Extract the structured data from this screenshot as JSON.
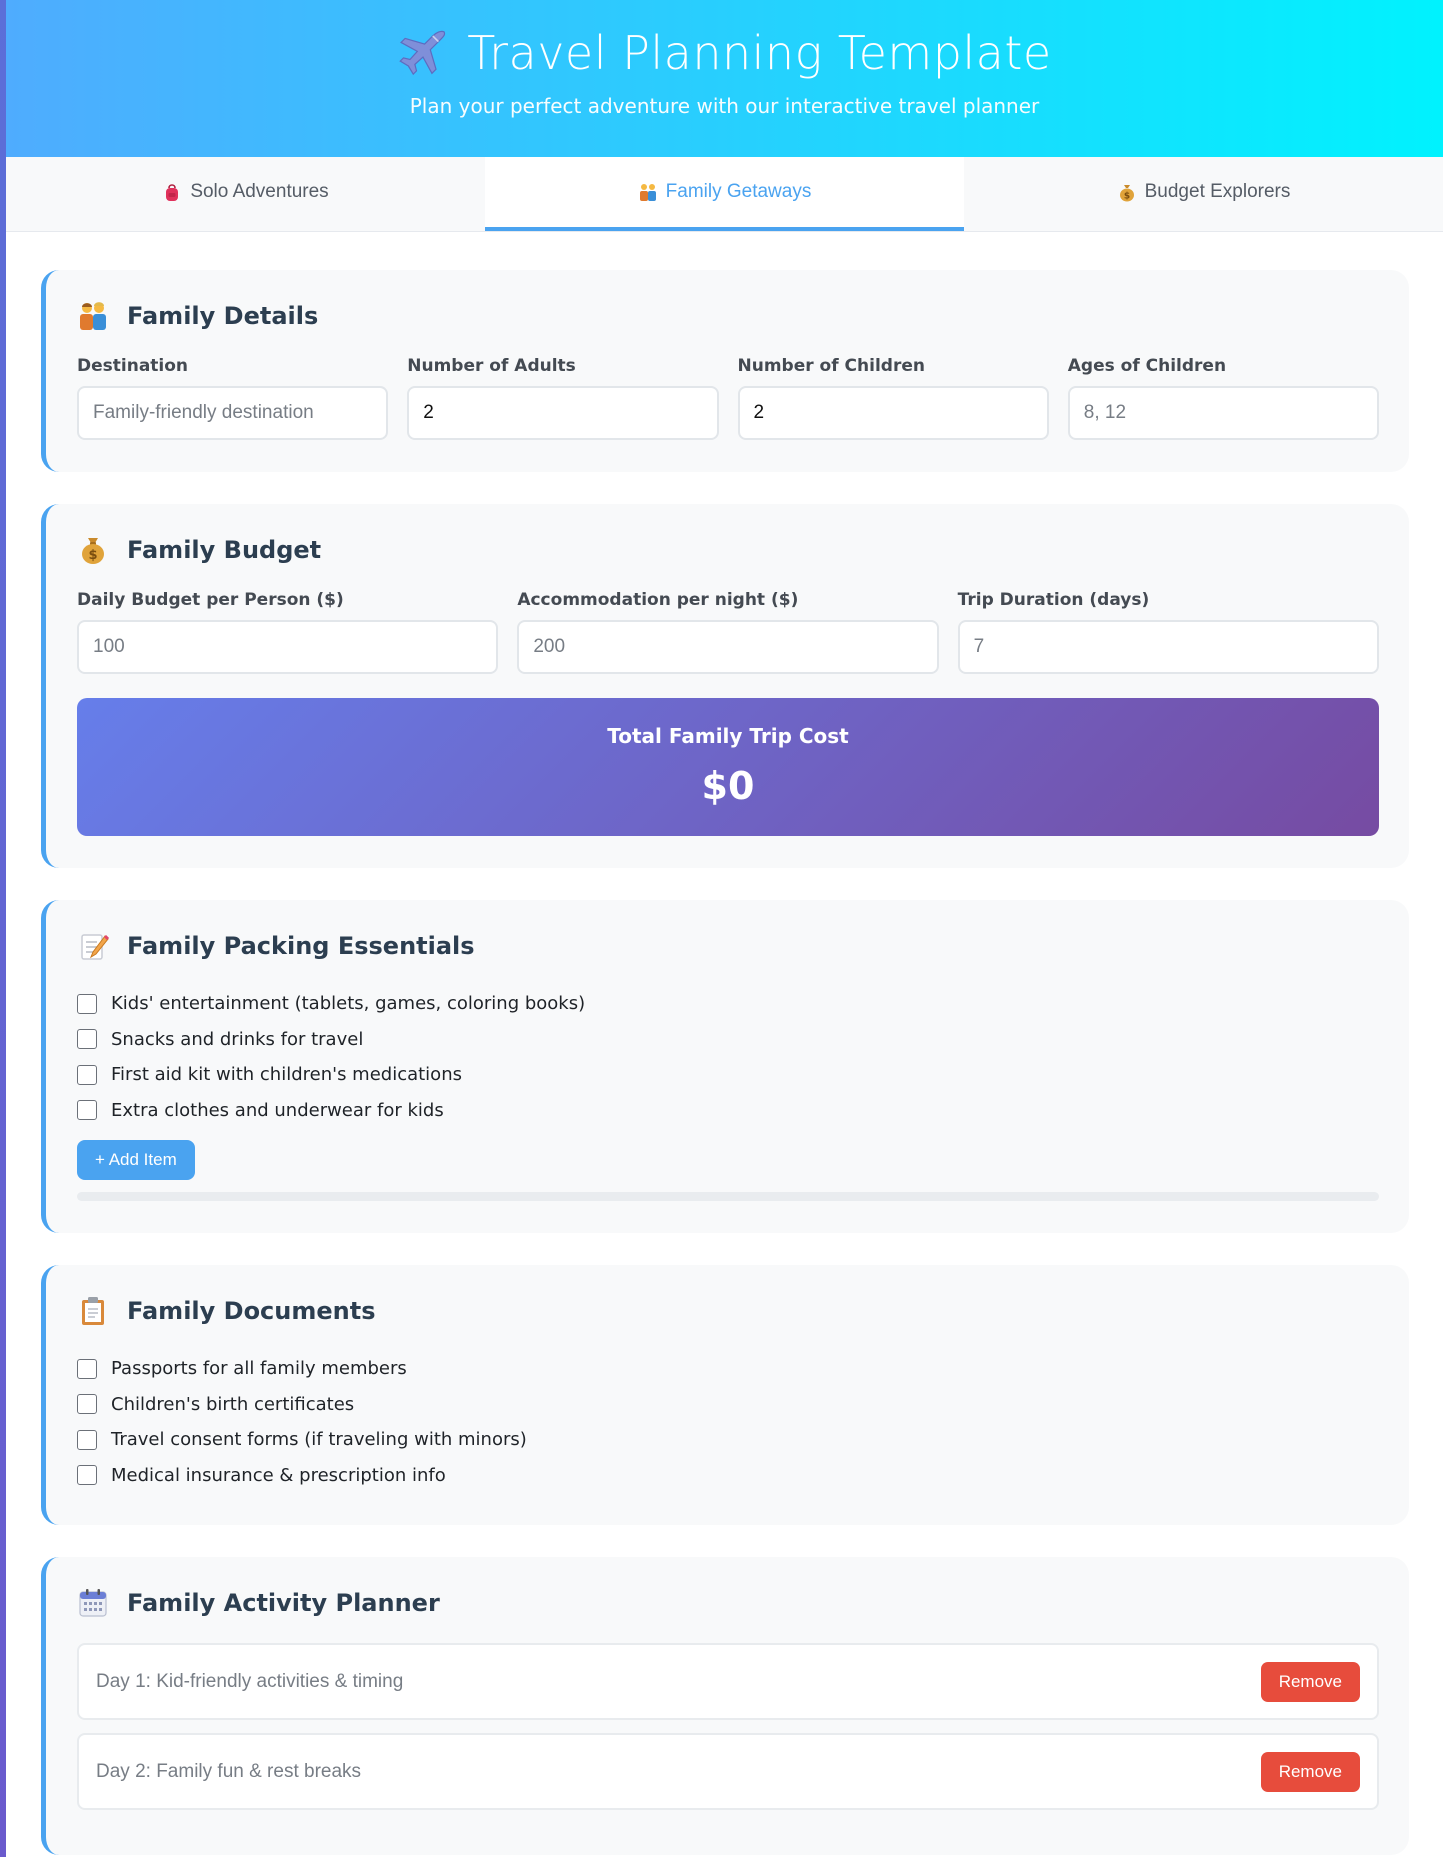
{
  "header": {
    "title": "Travel Planning Template",
    "subtitle": "Plan your perfect adventure with our interactive travel planner",
    "icon": "airplane-icon"
  },
  "tabs": [
    {
      "label": "Solo Adventures",
      "icon": "backpack-icon",
      "active": false
    },
    {
      "label": "Family Getaways",
      "icon": "family-icon",
      "active": true
    },
    {
      "label": "Budget Explorers",
      "icon": "money-bag-icon",
      "active": false
    }
  ],
  "family_details": {
    "title": "Family Details",
    "icon": "family-icon",
    "fields": [
      {
        "label": "Destination",
        "value": "",
        "placeholder": "Family-friendly destination"
      },
      {
        "label": "Number of Adults",
        "value": "2",
        "placeholder": ""
      },
      {
        "label": "Number of Children",
        "value": "2",
        "placeholder": ""
      },
      {
        "label": "Ages of Children",
        "value": "",
        "placeholder": "8, 12"
      }
    ]
  },
  "family_budget": {
    "title": "Family Budget",
    "icon": "money-bag-icon",
    "fields": [
      {
        "label": "Daily Budget per Person ($)",
        "value": "",
        "placeholder": "100"
      },
      {
        "label": "Accommodation per night ($)",
        "value": "",
        "placeholder": "200"
      },
      {
        "label": "Trip Duration (days)",
        "value": "",
        "placeholder": "7"
      }
    ],
    "total_label": "Total Family Trip Cost",
    "total_value": "$0"
  },
  "packing": {
    "title": "Family Packing Essentials",
    "icon": "memo-icon",
    "items": [
      "Kids' entertainment (tablets, games, coloring books)",
      "Snacks and drinks for travel",
      "First aid kit with children's medications",
      "Extra clothes and underwear for kids"
    ],
    "add_label": "+ Add Item",
    "progress_percent": 0
  },
  "documents": {
    "title": "Family Documents",
    "icon": "clipboard-icon",
    "items": [
      "Passports for all family members",
      "Children's birth certificates",
      "Travel consent forms (if traveling with minors)",
      "Medical insurance & prescription info"
    ]
  },
  "activities": {
    "title": "Family Activity Planner",
    "icon": "calendar-icon",
    "days": [
      {
        "placeholder": "Day 1: Kid-friendly activities & timing",
        "remove_label": "Remove"
      },
      {
        "placeholder": "Day 2: Family fun & rest breaks",
        "remove_label": "Remove"
      }
    ]
  },
  "colors": {
    "header_start": "#4facfe",
    "header_end": "#00f2fe",
    "accent": "#4aa3f0",
    "total_start": "#667eea",
    "total_end": "#764ba2",
    "danger": "#e74c3c"
  }
}
